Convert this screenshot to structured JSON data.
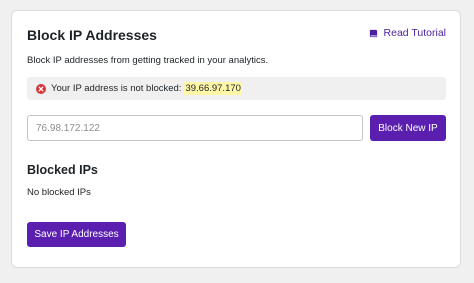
{
  "header": {
    "title": "Block IP Addresses",
    "tutorial_link": "Read Tutorial"
  },
  "description": "Block IP addresses from getting tracked in your analytics.",
  "notice": {
    "message": "Your IP address is not blocked:",
    "ip": "39.66.97.170"
  },
  "ip_input": {
    "placeholder": "76.98.172.122",
    "value": ""
  },
  "block_button": "Block New IP",
  "blocked_section": {
    "title": "Blocked IPs",
    "empty_text": "No blocked IPs"
  },
  "save_button": "Save IP Addresses",
  "colors": {
    "accent": "#5b1fb0",
    "link": "#4a1fa0",
    "error": "#d63638",
    "highlight": "#fff6a8"
  },
  "icons": {
    "tutorial": "book-icon",
    "notice": "error-icon"
  }
}
